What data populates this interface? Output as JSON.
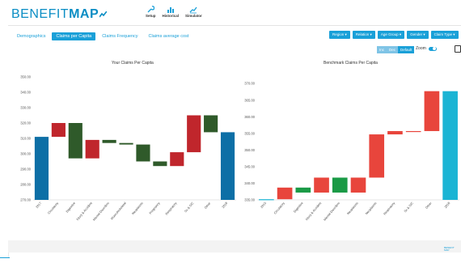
{
  "app": {
    "logo_text": "BENEFIT",
    "logo_bold": "MAP",
    "brand_color": "#0a8dc4"
  },
  "toolbar": [
    {
      "label": "Setup",
      "icon": "wrench-icon"
    },
    {
      "label": "Historical",
      "icon": "bar-chart-icon"
    },
    {
      "label": "Simulator",
      "icon": "trend-line-icon"
    }
  ],
  "tabs": [
    {
      "label": "Demographics",
      "active": false
    },
    {
      "label": "Claims per Capita",
      "active": true
    },
    {
      "label": "Claims Frequency",
      "active": false
    },
    {
      "label": "Claims average cost",
      "active": false
    }
  ],
  "filters": [
    {
      "label": "Region ▾"
    },
    {
      "label": "Relation ▾"
    },
    {
      "label": "Age Group ▾"
    },
    {
      "label": "Gender ▾"
    },
    {
      "label": "Claim Type ▾"
    }
  ],
  "view_toggle": [
    {
      "label": "Inc",
      "active": false
    },
    {
      "label": "Dec",
      "active": false
    },
    {
      "label": "Default",
      "active": true
    }
  ],
  "zoom": {
    "label": "Zoom",
    "enabled": true
  },
  "colors": {
    "endpoint_left": "#0d6fa6",
    "endpoint_right": "#1ab4d4",
    "increase": "#c0262c",
    "decrease": "#2f5a2a",
    "increase_bench": "#e8453c",
    "decrease_bench": "#1a9a46"
  },
  "footer": {
    "line1": "BENEFIT",
    "line2": "MAP"
  },
  "chart_data": [
    {
      "type": "bar",
      "subtype": "waterfall",
      "title": "Your Claims Per Capita",
      "categories": [
        "2017",
        "Circulatory",
        "Digestive",
        "Injury & Accident",
        "Mental Disorders",
        "Musculoskeletal",
        "Neoplasms",
        "Pregnancy",
        "Respiratory",
        "Sx & S/C",
        "Other",
        "2018"
      ],
      "values": [
        311,
        9,
        -23,
        12,
        -2,
        -1,
        -11,
        -3,
        9,
        24,
        -11,
        20
      ],
      "ylim": [
        270,
        350
      ],
      "yticks": [
        "270.00",
        "280.00",
        "290.00",
        "300.00",
        "310.00",
        "320.00",
        "330.00",
        "340.00",
        "350.00"
      ],
      "grid": false
    },
    {
      "type": "bar",
      "subtype": "waterfall",
      "title": "Benchmark Claims Per Capita",
      "categories": [
        "2015",
        "Circulatory",
        "Digestive",
        "Injury & Accident",
        "Mental Disorders",
        "Neoplasms",
        "Neoplasms",
        "Respiratory",
        "Sx & S/C",
        "Other",
        "2018"
      ],
      "values": [
        335.2,
        3.5,
        -1.5,
        4.5,
        -4.5,
        4.5,
        13,
        1,
        0,
        12,
        12
      ],
      "ylim": [
        335,
        372
      ],
      "yticks": [
        "335.00",
        "340.00",
        "345.00",
        "350.00",
        "355.00",
        "360.00",
        "365.00",
        "370.00"
      ],
      "grid": false
    }
  ]
}
